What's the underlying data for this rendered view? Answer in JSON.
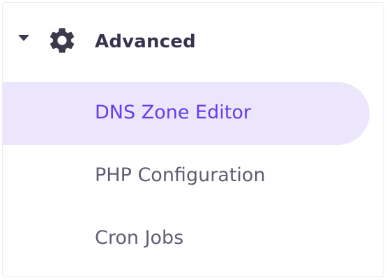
{
  "section": {
    "title": "Advanced",
    "expanded": true,
    "icon": "gear-icon",
    "toggle_icon": "caret-down-icon"
  },
  "items": [
    {
      "label": "DNS Zone Editor",
      "active": true
    },
    {
      "label": "PHP Configuration",
      "active": false
    },
    {
      "label": "Cron Jobs",
      "active": false
    }
  ],
  "colors": {
    "accent": "#673de6",
    "active_bg": "#ebe6fb",
    "text": "#5f5e72",
    "header_text": "#36344d",
    "icon": "#3a3a4a"
  }
}
